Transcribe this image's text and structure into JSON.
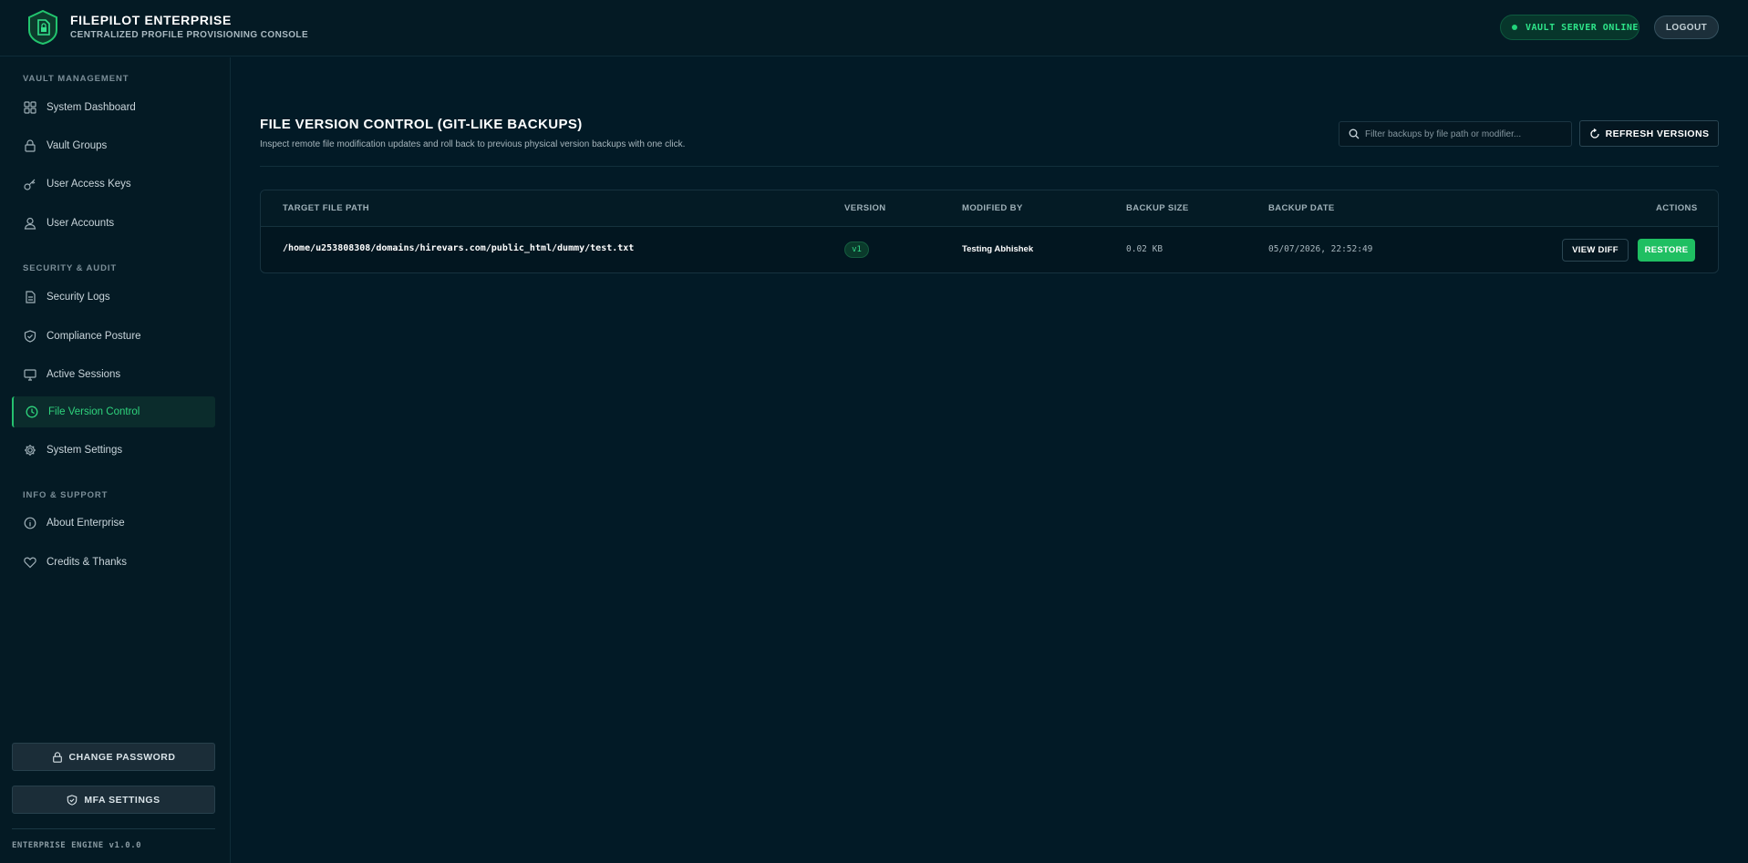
{
  "header": {
    "title": "FILEPILOT ENTERPRISE",
    "subtitle": "CENTRALIZED PROFILE PROVISIONING CONSOLE",
    "status": "VAULT SERVER ONLINE",
    "logout_label": "LOGOUT",
    "logo_icon": "shield-file-icon"
  },
  "sidebar": {
    "sections": [
      {
        "label": "VAULT MANAGEMENT",
        "items": [
          {
            "label": "System Dashboard",
            "icon": "grid-icon"
          },
          {
            "label": "Vault Groups",
            "icon": "lock-icon"
          },
          {
            "label": "User Access Keys",
            "icon": "key-icon"
          },
          {
            "label": "User Accounts",
            "icon": "users-icon"
          }
        ]
      },
      {
        "label": "SECURITY & AUDIT",
        "items": [
          {
            "label": "Security Logs",
            "icon": "document-icon"
          },
          {
            "label": "Compliance Posture",
            "icon": "shield-check-icon"
          },
          {
            "label": "Active Sessions",
            "icon": "monitor-icon"
          },
          {
            "label": "File Version Control",
            "icon": "clock-icon",
            "active": true
          },
          {
            "label": "System Settings",
            "icon": "gear-icon"
          }
        ]
      },
      {
        "label": "INFO & SUPPORT",
        "items": [
          {
            "label": "About Enterprise",
            "icon": "info-icon"
          },
          {
            "label": "Credits & Thanks",
            "icon": "heart-icon"
          }
        ]
      }
    ],
    "change_password_label": "CHANGE PASSWORD",
    "mfa_label": "MFA SETTINGS",
    "engine_version": "ENTERPRISE ENGINE v1.0.0"
  },
  "main": {
    "title": "FILE VERSION CONTROL (GIT-LIKE BACKUPS)",
    "description": "Inspect remote file modification updates and roll back to previous physical version backups with one click.",
    "search_placeholder": "Filter backups by file path or modifier...",
    "refresh_label": "REFRESH VERSIONS",
    "table": {
      "columns": [
        "TARGET FILE PATH",
        "VERSION",
        "MODIFIED BY",
        "BACKUP SIZE",
        "BACKUP DATE",
        "ACTIONS"
      ],
      "rows": [
        {
          "path": "/home/u253808308/domains/hirevars.com/public_html/dummy/test.txt",
          "version": "v1",
          "modified_by": "Testing Abhishek",
          "size": "0.02 KB",
          "date": "05/07/2026, 22:52:49",
          "diff_label": "VIEW DIFF",
          "restore_label": "RESTORE"
        }
      ]
    }
  },
  "colors": {
    "accent": "#22c46e",
    "background": "#021a26",
    "panel": "#041a24"
  }
}
